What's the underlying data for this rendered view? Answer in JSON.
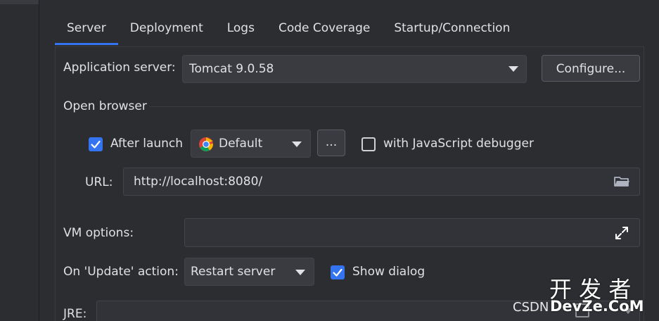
{
  "tabs": [
    "Server",
    "Deployment",
    "Logs",
    "Code Coverage",
    "Startup/Connection"
  ],
  "app_server": {
    "label": "Application server:",
    "value": "Tomcat 9.0.58",
    "configure_label": "Configure..."
  },
  "open_browser": {
    "title": "Open browser",
    "after_launch_label": "After launch",
    "after_launch_checked": true,
    "browser_value": "Default",
    "more_label": "...",
    "js_debugger_label": "with JavaScript debugger",
    "js_debugger_checked": false,
    "url_label": "URL:",
    "url_value": "http://localhost:8080/"
  },
  "vm_options": {
    "label": "VM options:",
    "value": ""
  },
  "update_action": {
    "label": "On 'Update' action:",
    "value": "Restart server",
    "show_dialog_label": "Show dialog",
    "show_dialog_checked": true
  },
  "jre": {
    "label": "JRE:"
  },
  "watermark": {
    "site": "CSDN",
    "brand_cn": "开 发 者",
    "brand_en": "DevZe.CoM"
  },
  "colors": {
    "accent": "#3574f0",
    "background": "#2b2d30",
    "control": "#393b40"
  },
  "icons": {
    "browser": "chrome-icon",
    "folder": "folder-icon",
    "expand": "expand-icon",
    "dropdown": "chevron-down-icon"
  }
}
